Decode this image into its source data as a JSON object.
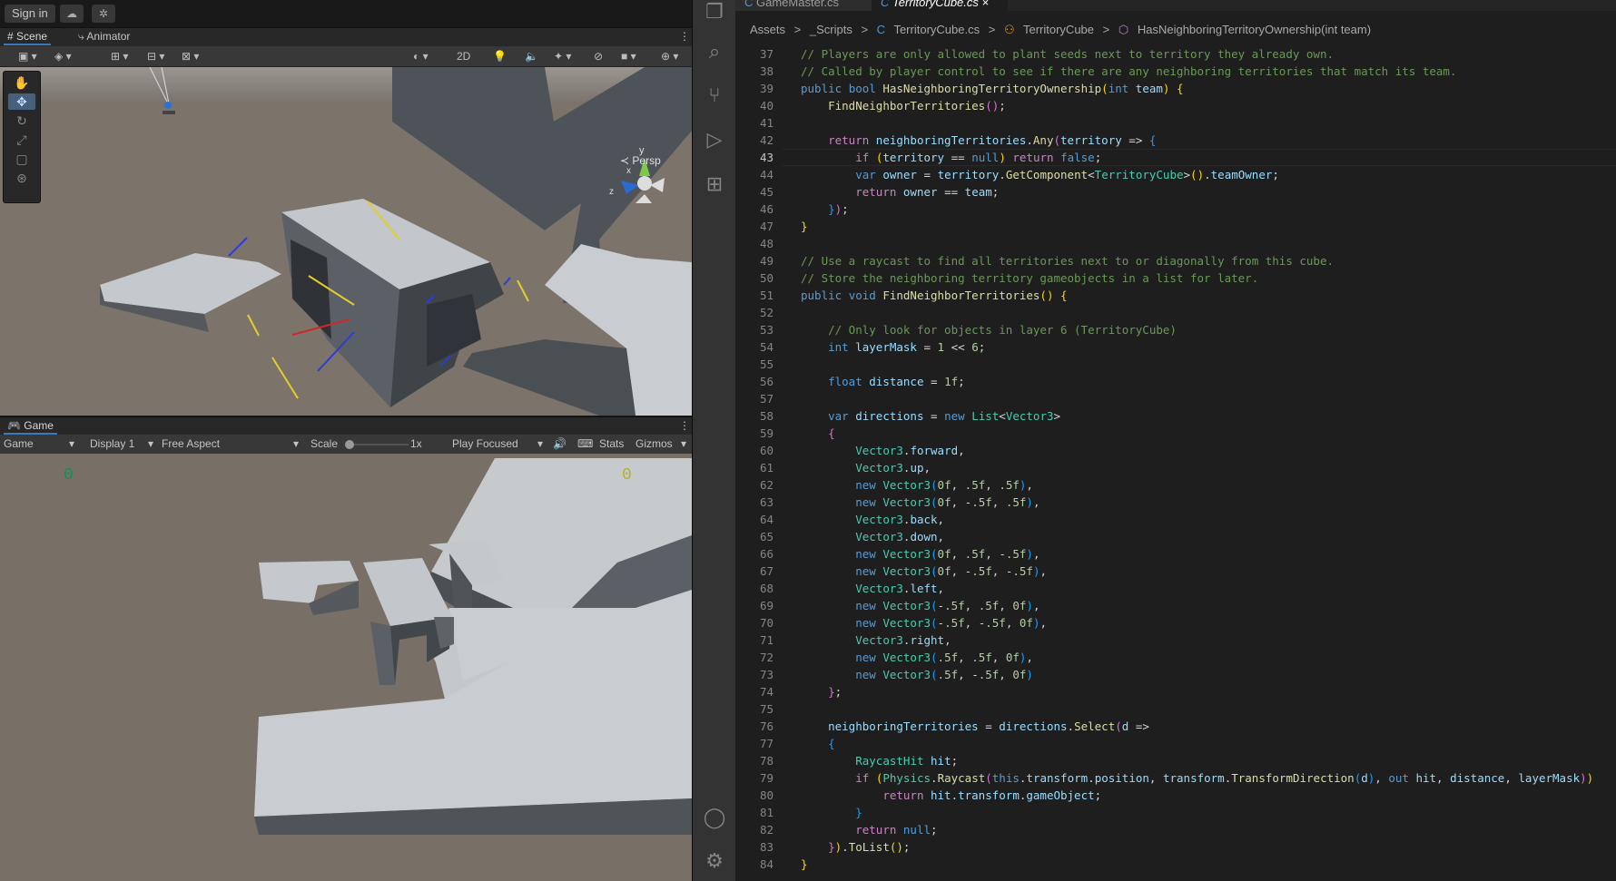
{
  "unity": {
    "signin_label": "Sign in",
    "scene_tab": "Scene",
    "animator_tab": "Animator",
    "mode_2d": "2D",
    "persp_label": "Persp",
    "axis_x": "x",
    "axis_y": "y",
    "axis_z": "z",
    "game_tab": "Game",
    "game_bar": {
      "game": "Game",
      "display": "Display 1",
      "aspect": "Free Aspect",
      "scale_label": "Scale",
      "scale_value": "1x",
      "play_mode": "Play Focused",
      "stats": "Stats",
      "gizmos": "Gizmos"
    },
    "score_left": "0",
    "score_right": "0",
    "colors": {
      "score_left": "#1e8a5a",
      "score_right": "#b8b02c",
      "accent": "#3a79bb"
    }
  },
  "activity_bar": [
    "files-icon",
    "search-icon",
    "source-control-icon",
    "run-debug-icon",
    "extensions-icon",
    "account-icon",
    "settings-icon"
  ],
  "editor": {
    "tabs": [
      {
        "label": "GameMaster.cs",
        "active": false
      },
      {
        "label": "TerritoryCube.cs",
        "active": true,
        "close": "×"
      }
    ],
    "breadcrumb": [
      "Assets",
      ">",
      "_Scripts",
      ">",
      "TerritoryCube.cs",
      ">",
      "TerritoryCube",
      ">",
      "HasNeighboringTerritoryOwnership(int team)"
    ],
    "current_line": 43,
    "lines": [
      {
        "n": "37",
        "t": "// Players are only allowed to plant seeds next to territory they already own."
      },
      {
        "n": "38",
        "t": "// Called by player control to see if there are any neighboring territories that match its team."
      },
      {
        "n": "39",
        "t": "public bool HasNeighboringTerritoryOwnership(int team) {"
      },
      {
        "n": "40",
        "t": "    FindNeighborTerritories();"
      },
      {
        "n": "41",
        "t": ""
      },
      {
        "n": "42",
        "t": "    return neighboringTerritories.Any(territory => {"
      },
      {
        "n": "43",
        "t": "        if (territory == null) return false;"
      },
      {
        "n": "44",
        "t": "        var owner = territory.GetComponent<TerritoryCube>().teamOwner;"
      },
      {
        "n": "45",
        "t": "        return owner == team;"
      },
      {
        "n": "46",
        "t": "    });"
      },
      {
        "n": "47",
        "t": "}"
      },
      {
        "n": "48",
        "t": ""
      },
      {
        "n": "49",
        "t": "// Use a raycast to find all territories next to or diagonally from this cube."
      },
      {
        "n": "50",
        "t": "// Store the neighboring territory gameobjects in a list for later."
      },
      {
        "n": "51",
        "t": "public void FindNeighborTerritories() {"
      },
      {
        "n": "52",
        "t": ""
      },
      {
        "n": "53",
        "t": "    // Only look for objects in layer 6 (TerritoryCube)"
      },
      {
        "n": "54",
        "t": "    int layerMask = 1 << 6;"
      },
      {
        "n": "55",
        "t": ""
      },
      {
        "n": "56",
        "t": "    float distance = 1f;"
      },
      {
        "n": "57",
        "t": ""
      },
      {
        "n": "58",
        "t": "    var directions = new List<Vector3>"
      },
      {
        "n": "59",
        "t": "    {"
      },
      {
        "n": "60",
        "t": "        Vector3.forward,"
      },
      {
        "n": "61",
        "t": "        Vector3.up,"
      },
      {
        "n": "62",
        "t": "        new Vector3(0f, .5f, .5f),"
      },
      {
        "n": "63",
        "t": "        new Vector3(0f, -.5f, .5f),"
      },
      {
        "n": "64",
        "t": "        Vector3.back,"
      },
      {
        "n": "65",
        "t": "        Vector3.down,"
      },
      {
        "n": "66",
        "t": "        new Vector3(0f, .5f, -.5f),"
      },
      {
        "n": "67",
        "t": "        new Vector3(0f, -.5f, -.5f),"
      },
      {
        "n": "68",
        "t": "        Vector3.left,"
      },
      {
        "n": "69",
        "t": "        new Vector3(-.5f, .5f, 0f),"
      },
      {
        "n": "70",
        "t": "        new Vector3(-.5f, -.5f, 0f),"
      },
      {
        "n": "71",
        "t": "        Vector3.right,"
      },
      {
        "n": "72",
        "t": "        new Vector3(.5f, .5f, 0f),"
      },
      {
        "n": "73",
        "t": "        new Vector3(.5f, -.5f, 0f)"
      },
      {
        "n": "74",
        "t": "    };"
      },
      {
        "n": "75",
        "t": ""
      },
      {
        "n": "76",
        "t": "    neighboringTerritories = directions.Select(d =>"
      },
      {
        "n": "77",
        "t": "    {"
      },
      {
        "n": "78",
        "t": "        RaycastHit hit;"
      },
      {
        "n": "79",
        "t": "        if (Physics.Raycast(this.transform.position, transform.TransformDirection(d), out hit, distance, layerMask))"
      },
      {
        "n": "80",
        "t": "            return hit.transform.gameObject;"
      },
      {
        "n": "81",
        "t": "        }"
      },
      {
        "n": "82",
        "t": "        return null;"
      },
      {
        "n": "83",
        "t": "    }).ToList();"
      },
      {
        "n": "84",
        "t": "}"
      }
    ]
  }
}
